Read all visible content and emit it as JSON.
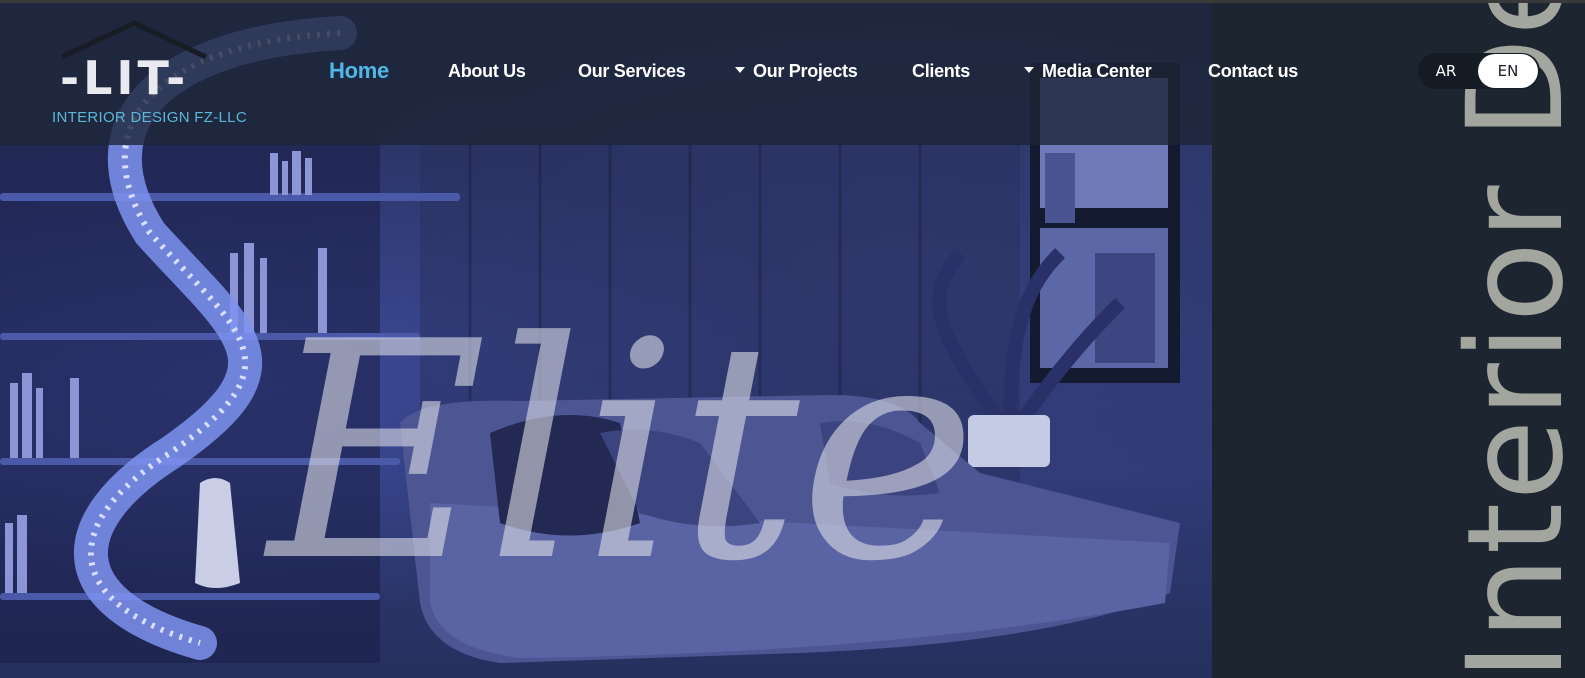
{
  "brand": {
    "logo_mark": "-LIT-",
    "logo_subtitle": "INTERIOR DESIGN FZ-LLC"
  },
  "nav": {
    "items": [
      {
        "label": "Home",
        "active": true,
        "dropdown": false
      },
      {
        "label": "About Us",
        "active": false,
        "dropdown": false
      },
      {
        "label": "Our Services",
        "active": false,
        "dropdown": false
      },
      {
        "label": "Our Projects",
        "active": false,
        "dropdown": true
      },
      {
        "label": "Clients",
        "active": false,
        "dropdown": false
      },
      {
        "label": "Media Center",
        "active": false,
        "dropdown": true
      },
      {
        "label": "Contact us",
        "active": false,
        "dropdown": false
      }
    ]
  },
  "language": {
    "options": [
      "AR",
      "EN"
    ],
    "selected": "EN"
  },
  "hero": {
    "script_text": "Elite",
    "vertical_text": "Interior Design"
  },
  "colors": {
    "accent": "#4fb7e6",
    "panel": "#1d2630",
    "hero_tint": "#2b3569",
    "vertical_text": "#a3a69e"
  }
}
